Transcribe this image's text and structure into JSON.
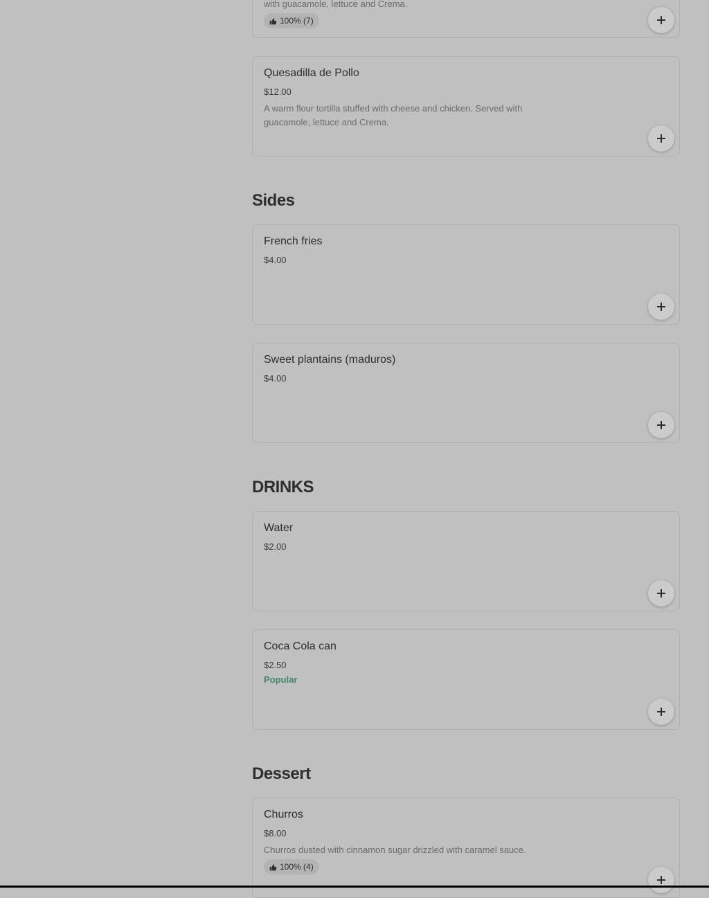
{
  "top_partial_item": {
    "description_tail": "with guacamole, lettuce and Crema.",
    "rating": "100% (7)"
  },
  "sections": {
    "sides_title": "Sides",
    "drinks_title": "DRINKS",
    "dessert_title": "Dessert"
  },
  "items": {
    "quesadilla": {
      "name": "Quesadilla de Pollo",
      "price": "$12.00",
      "description": "A warm flour tortilla stuffed with cheese and chicken. Served with guacamole, lettuce and Crema."
    },
    "french_fries": {
      "name": "French fries",
      "price": "$4.00"
    },
    "plantains": {
      "name": "Sweet plantains (maduros)",
      "price": "$4.00"
    },
    "water": {
      "name": "Water",
      "price": "$2.00"
    },
    "coca_cola": {
      "name": "Coca Cola can",
      "price": "$2.50",
      "badge": "Popular"
    },
    "churros": {
      "name": "Churros",
      "price": "$8.00",
      "description": "Churros dusted with cinnamon sugar drizzled with caramel sauce.",
      "rating": "100% (4)"
    }
  },
  "icons": {
    "add": "plus-icon",
    "rating": "thumbs-up-icon"
  },
  "colors": {
    "popular": "#3e8a62",
    "overlay_bg": "#c0c0c0"
  }
}
